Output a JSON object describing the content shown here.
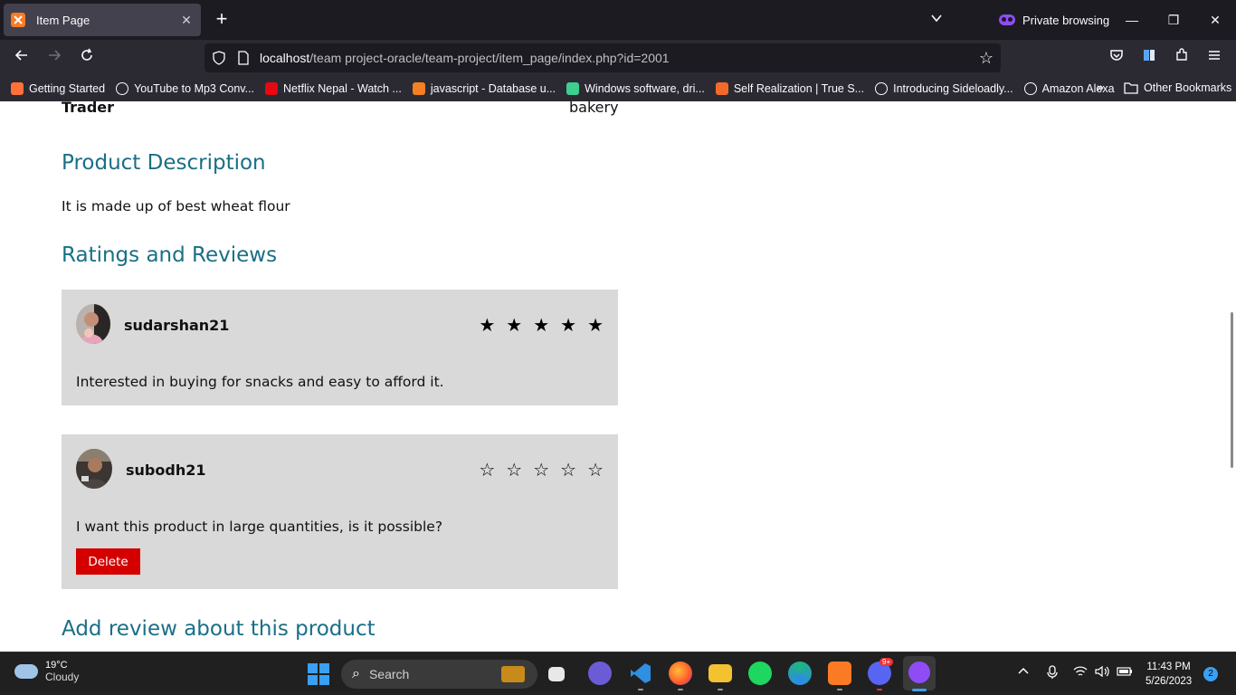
{
  "browser": {
    "tab_title": "Item Page",
    "private_label": "Private browsing",
    "url_host": "localhost",
    "url_path": "/team project-oracle/team-project/item_page/index.php?id=2001",
    "bookmarks": [
      {
        "label": "Getting Started",
        "icon": "firefox-icon",
        "color": "#ff7139"
      },
      {
        "label": "YouTube to Mp3 Conv...",
        "icon": "globe-icon",
        "color": "#fbfbfe"
      },
      {
        "label": "Netflix Nepal - Watch ...",
        "icon": "netflix-icon",
        "color": "#e50914"
      },
      {
        "label": "javascript - Database u...",
        "icon": "stackoverflow-icon",
        "color": "#f48024"
      },
      {
        "label": "Windows software, dri...",
        "icon": "softpedia-icon",
        "color": "#3ecf8e"
      },
      {
        "label": "Self Realization | True S...",
        "icon": "flame-icon",
        "color": "#f06a2a"
      },
      {
        "label": "Introducing Sideloadly...",
        "icon": "globe-icon",
        "color": "#fbfbfe"
      },
      {
        "label": "Amazon Alexa",
        "icon": "globe-icon",
        "color": "#fbfbfe"
      }
    ],
    "other_bookmarks": "Other Bookmarks"
  },
  "page": {
    "trader_label": "Trader",
    "trader_value": "bakery",
    "description_heading": "Product Description",
    "description_text": "It is made up of best wheat flour",
    "reviews_heading": "Ratings and Reviews",
    "reviews": [
      {
        "username": "sudarshan21",
        "rating": 5,
        "text": "Interested in buying for snacks and easy to afford it.",
        "deletable": false
      },
      {
        "username": "subodh21",
        "rating": 0,
        "text": "I want this product in large quantities, is it possible?",
        "deletable": true
      }
    ],
    "delete_label": "Delete",
    "add_review_heading": "Add review about this product"
  },
  "taskbar": {
    "temperature": "19°C",
    "condition": "Cloudy",
    "search_placeholder": "Search",
    "time": "11:43 PM",
    "date": "5/26/2023",
    "notification_count": "2",
    "discord_badge": "9+"
  },
  "colors": {
    "heading": "#1a6f86",
    "review_bg": "#d9d9d9",
    "delete": "#d40000"
  }
}
